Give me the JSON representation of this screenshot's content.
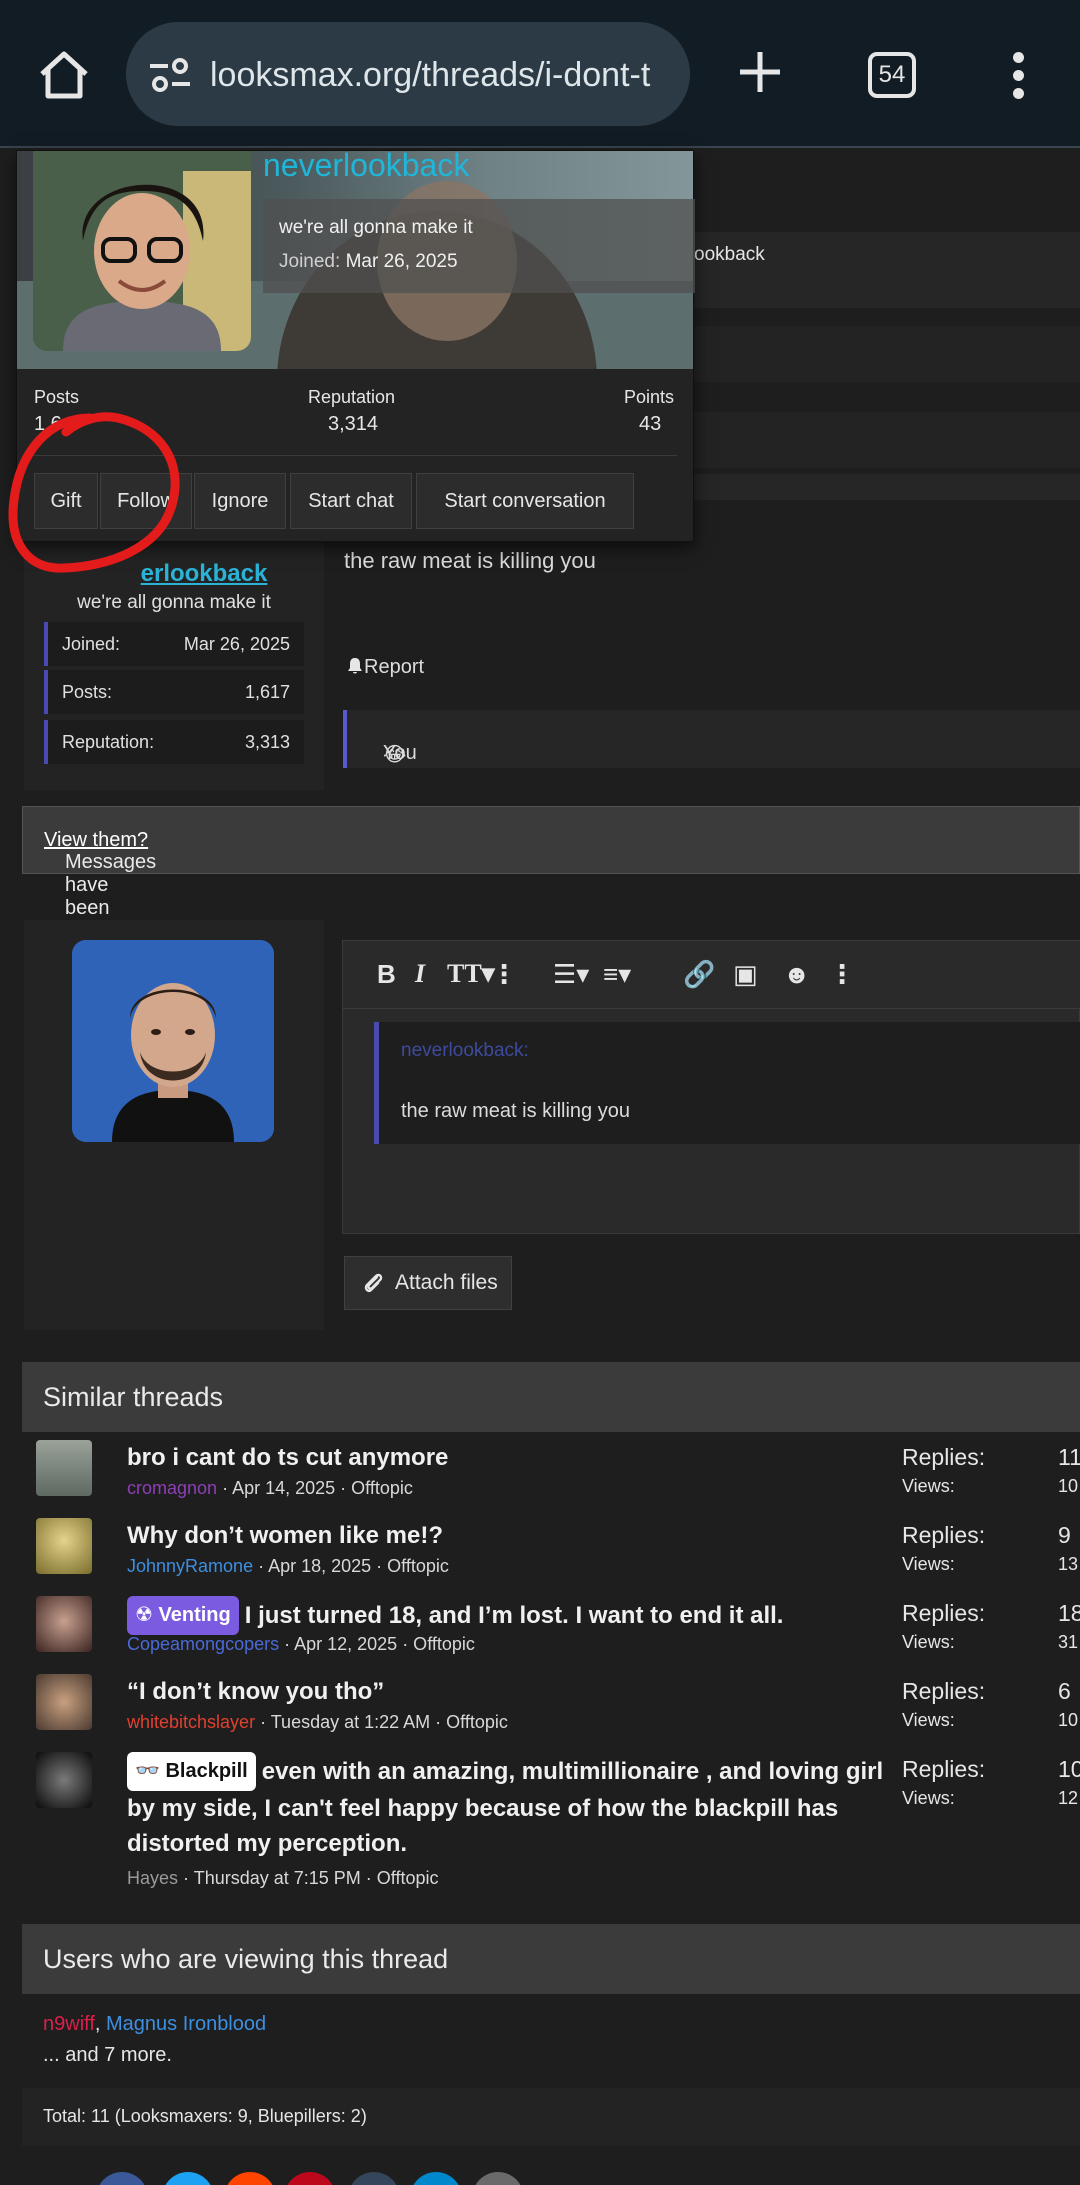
{
  "browser": {
    "url": "looksmax.org/threads/i-dont-t",
    "tab_count": "54"
  },
  "popup_card": {
    "username": "neverlookback",
    "user_title": "we're all gonna make it",
    "joined_label": "Joined:",
    "joined_value": "Mar 26, 2025",
    "stats": [
      {
        "label": "Posts",
        "value": "1,6"
      },
      {
        "label": "Reputation",
        "value": "3,314"
      },
      {
        "label": "Points",
        "value": "43"
      }
    ],
    "buttons": [
      "Gift",
      "Follow",
      "Ignore",
      "Start chat",
      "Start conversation"
    ]
  },
  "behind_card": {
    "mention_fragment": "ookback"
  },
  "post": {
    "author": "neverlookback",
    "author_partial": "erlookback",
    "user_title": "we're all gonna make it",
    "stats": [
      {
        "label": "Joined:",
        "value": "Mar 26, 2025"
      },
      {
        "label": "Posts:",
        "value": "1,617"
      },
      {
        "label": "Reputation:",
        "value": "3,313"
      }
    ],
    "body": "the raw meat is killing you",
    "report_label": "Report",
    "reaction_label": "You",
    "reaction_emoji": "😂"
  },
  "notice": {
    "text": "Messages have been posted since you loaded this page. ",
    "link": "View them?"
  },
  "reply": {
    "quote_author": "neverlookback:",
    "quote_text": "the raw meat is killing you",
    "attach_label": "Attach files"
  },
  "similar_threads": {
    "heading": "Similar threads",
    "items": [
      {
        "title": "bro i cant do ts cut anymore",
        "prefix": "",
        "author": "cromagnon",
        "author_color": "#8e3fb5",
        "meta": " · Apr 14, 2025 · Offtopic",
        "replies_label": "Replies:",
        "replies": "11",
        "views_label": "Views:",
        "views": "10"
      },
      {
        "title": "Why don’t women like me!?",
        "prefix": "",
        "author": "JohnnyRamone",
        "author_color": "#3d8fe0",
        "meta": " · Apr 18, 2025 · Offtopic",
        "replies_label": "Replies:",
        "replies": "9",
        "views_label": "Views:",
        "views": "13"
      },
      {
        "title": "I just turned 18, and I’m lost. I want to end it all.",
        "prefix": "Venting",
        "author": "Copeamongcopers",
        "author_color": "#4a6ad6",
        "meta": " · Apr 12, 2025 · Offtopic",
        "replies_label": "Replies:",
        "replies": "18",
        "views_label": "Views:",
        "views": "31"
      },
      {
        "title": "“I don’t know you tho”",
        "prefix": "",
        "author": "whitebitchslayer",
        "author_color": "#e0402f",
        "meta": " · Tuesday at 1:22 AM · Offtopic",
        "replies_label": "Replies:",
        "replies": "6",
        "views_label": "Views:",
        "views": "10"
      },
      {
        "title": "even with an amazing, multimillionaire , and loving girl by my side, I can't feel happy because of how the blackpill has distorted my perception.",
        "prefix": "Blackpill",
        "author": "Hayes",
        "author_color": "#9a9a9a",
        "meta": " · Thursday at 7:15 PM · Offtopic",
        "replies_label": "Replies:",
        "replies": "10",
        "views_label": "Views:",
        "views": "12"
      }
    ]
  },
  "viewing": {
    "heading": "Users who are viewing this thread",
    "user1": "n9wiff",
    "user1_color": "#d8204a",
    "user2": "Magnus Ironblood",
    "user2_color": "#3d8fe0",
    "more": "... and 7 more.",
    "total": "Total: 11 (Looksmaxers: 9, Bluepillers: 2)"
  },
  "colors": {
    "accent_username": "#1fb6da",
    "quote_border": "#4a4ab0",
    "annotation_red": "#e41b1b"
  }
}
